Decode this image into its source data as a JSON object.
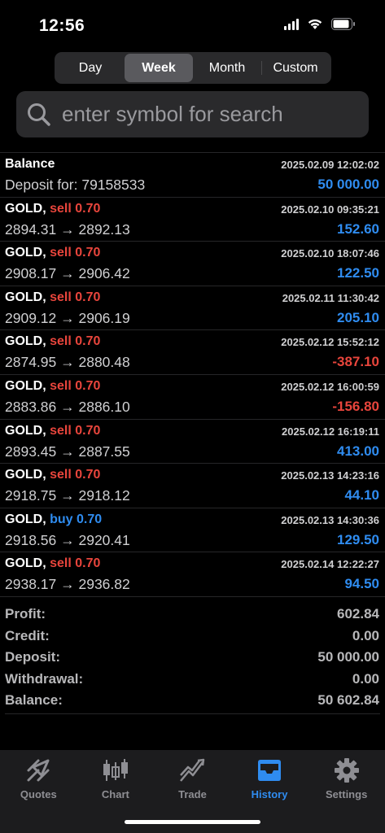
{
  "status": {
    "time": "12:56"
  },
  "segments": [
    {
      "label": "Day",
      "active": false
    },
    {
      "label": "Week",
      "active": true
    },
    {
      "label": "Month",
      "active": false
    },
    {
      "label": "Custom",
      "active": false
    }
  ],
  "search": {
    "placeholder": "enter symbol for search"
  },
  "balance_entry": {
    "title": "Balance",
    "subtitle": "Deposit for: 79158533",
    "date": "2025.02.09 12:02:02",
    "amount": "50 000.00"
  },
  "trades": [
    {
      "symbol": "GOLD,",
      "side": "sell",
      "volume": "0.70",
      "prices": "2894.31 → 2892.13",
      "date": "2025.02.10 09:35:21",
      "profit": "152.60",
      "positive": true
    },
    {
      "symbol": "GOLD,",
      "side": "sell",
      "volume": "0.70",
      "prices": "2908.17 → 2906.42",
      "date": "2025.02.10 18:07:46",
      "profit": "122.50",
      "positive": true
    },
    {
      "symbol": "GOLD,",
      "side": "sell",
      "volume": "0.70",
      "prices": "2909.12 → 2906.19",
      "date": "2025.02.11 11:30:42",
      "profit": "205.10",
      "positive": true
    },
    {
      "symbol": "GOLD,",
      "side": "sell",
      "volume": "0.70",
      "prices": "2874.95 → 2880.48",
      "date": "2025.02.12 15:52:12",
      "profit": "-387.10",
      "positive": false
    },
    {
      "symbol": "GOLD,",
      "side": "sell",
      "volume": "0.70",
      "prices": "2883.86 → 2886.10",
      "date": "2025.02.12 16:00:59",
      "profit": "-156.80",
      "positive": false
    },
    {
      "symbol": "GOLD,",
      "side": "sell",
      "volume": "0.70",
      "prices": "2893.45 → 2887.55",
      "date": "2025.02.12 16:19:11",
      "profit": "413.00",
      "positive": true
    },
    {
      "symbol": "GOLD,",
      "side": "sell",
      "volume": "0.70",
      "prices": "2918.75 → 2918.12",
      "date": "2025.02.13 14:23:16",
      "profit": "44.10",
      "positive": true
    },
    {
      "symbol": "GOLD,",
      "side": "buy",
      "volume": "0.70",
      "prices": "2918.56 → 2920.41",
      "date": "2025.02.13 14:30:36",
      "profit": "129.50",
      "positive": true
    },
    {
      "symbol": "GOLD,",
      "side": "sell",
      "volume": "0.70",
      "prices": "2938.17 → 2936.82",
      "date": "2025.02.14 12:22:27",
      "profit": "94.50",
      "positive": true
    }
  ],
  "summary": [
    {
      "label": "Profit:",
      "value": "602.84"
    },
    {
      "label": "Credit:",
      "value": "0.00"
    },
    {
      "label": "Deposit:",
      "value": "50 000.00"
    },
    {
      "label": "Withdrawal:",
      "value": "0.00"
    },
    {
      "label": "Balance:",
      "value": "50 602.84"
    }
  ],
  "tabs": [
    {
      "label": "Quotes",
      "icon": "quotes-icon",
      "active": false
    },
    {
      "label": "Chart",
      "icon": "chart-icon",
      "active": false
    },
    {
      "label": "Trade",
      "icon": "trade-icon",
      "active": false
    },
    {
      "label": "History",
      "icon": "history-icon",
      "active": true
    },
    {
      "label": "Settings",
      "icon": "gear-icon",
      "active": false
    }
  ],
  "colors": {
    "accent": "#2f8cf0",
    "negative": "#e8453c",
    "background": "#000000"
  }
}
